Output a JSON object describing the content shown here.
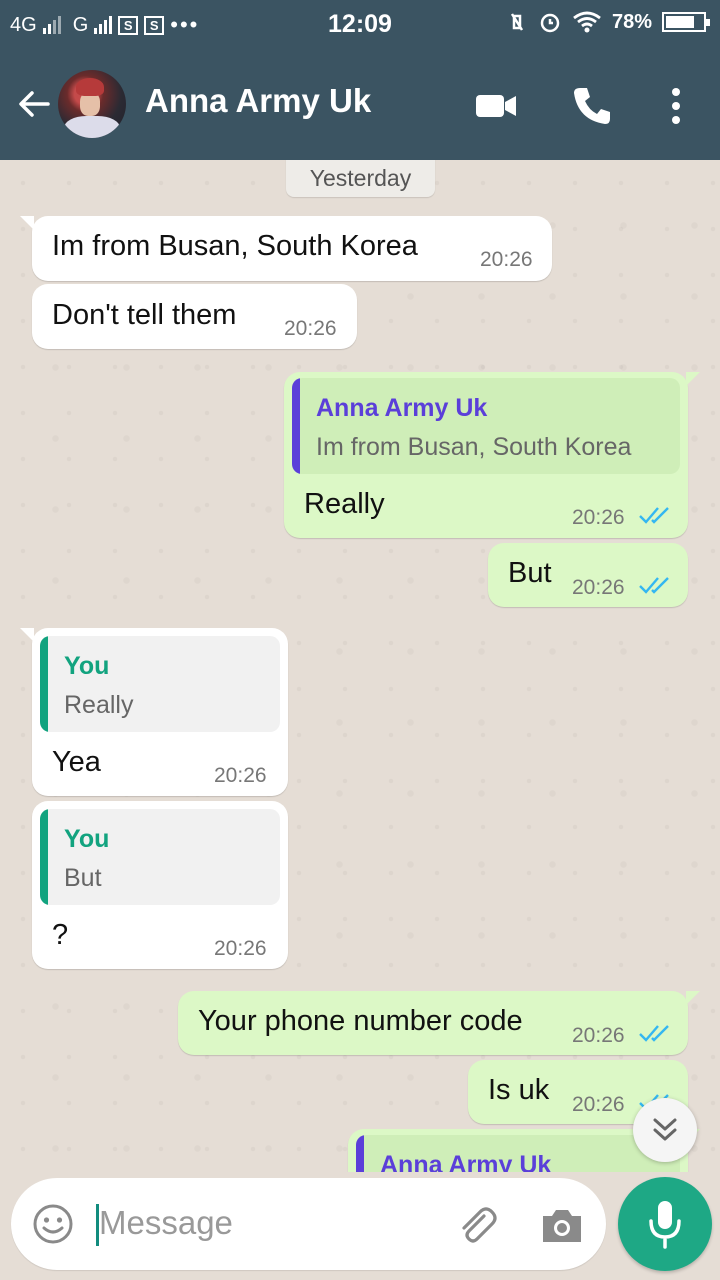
{
  "status_bar": {
    "network1": "4G",
    "network2": "G",
    "time": "12:09",
    "battery": "78%",
    "battery_level": 0.78
  },
  "header": {
    "contact_name": "Anna Army Uk"
  },
  "chat": {
    "date_divider": "Yesterday",
    "messages": [
      {
        "direction": "in",
        "text": "Im from Busan, South Korea",
        "time": "20:26"
      },
      {
        "direction": "in",
        "text": "Don't tell them",
        "time": "20:26"
      },
      {
        "direction": "out",
        "quote_name": "Anna Army Uk",
        "quote_text": "Im from Busan, South Korea",
        "text": "Really",
        "time": "20:26",
        "status": "read"
      },
      {
        "direction": "out",
        "text": "But",
        "time": "20:26",
        "status": "read"
      },
      {
        "direction": "in",
        "quote_name": "You",
        "quote_text": "Really",
        "text": "Yea",
        "time": "20:26"
      },
      {
        "direction": "in",
        "quote_name": "You",
        "quote_text": "But",
        "text": "?",
        "time": "20:26"
      },
      {
        "direction": "out",
        "text": "Your phone number code",
        "time": "20:26",
        "status": "read"
      },
      {
        "direction": "out",
        "text": "Is uk",
        "time": "20:26",
        "status": "read"
      },
      {
        "direction": "out",
        "quote_name": "Anna Army Uk",
        "quote_text": "",
        "text": "",
        "time": "",
        "status": "partially-visible"
      }
    ]
  },
  "input": {
    "placeholder": "Message"
  },
  "colors": {
    "header_bg": "#3b5462",
    "incoming_bubble": "#ffffff",
    "outgoing_bubble": "#dcf8c6",
    "quote_self_accent": "#12a37f",
    "quote_contact_accent": "#5b3fd9",
    "read_ticks": "#34b7f1",
    "mic_button": "#1ea885"
  },
  "icons": [
    "back-arrow-icon",
    "video-call-icon",
    "voice-call-icon",
    "more-options-icon",
    "double-chevron-down-icon",
    "emoji-icon",
    "attach-icon",
    "camera-icon",
    "mic-icon"
  ]
}
